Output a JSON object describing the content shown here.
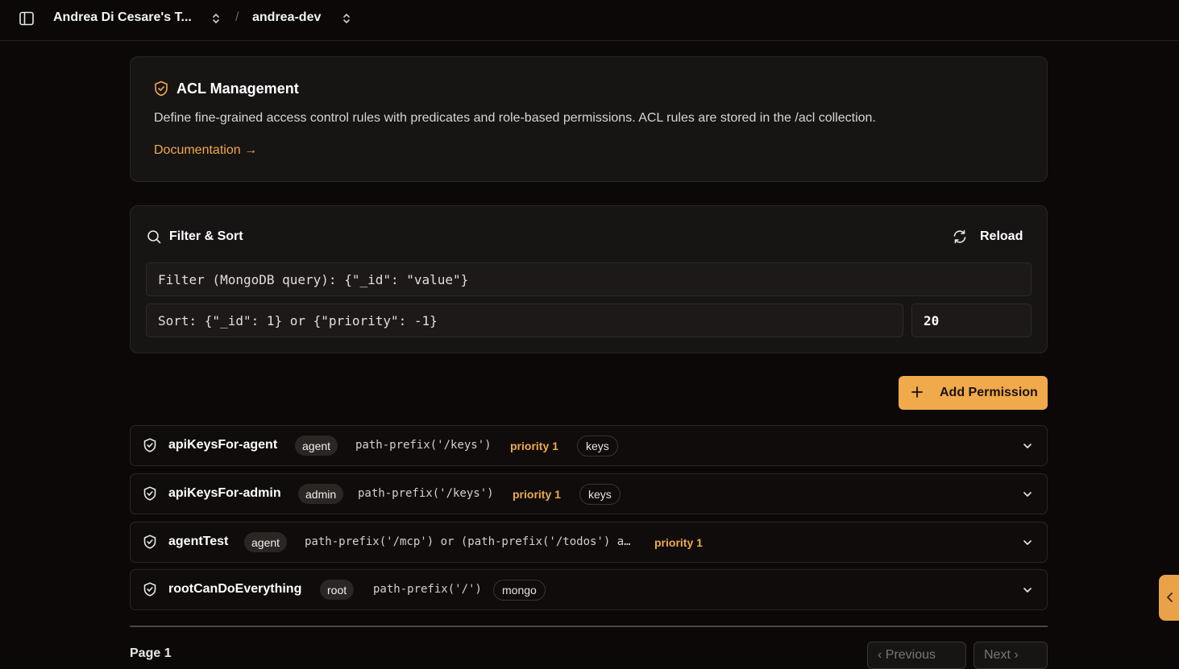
{
  "header": {
    "team_name": "Andrea Di Cesare's T...",
    "separator": "/",
    "project_name": "andrea-dev"
  },
  "acl": {
    "title": "ACL Management",
    "description": "Define fine-grained access control rules with predicates and role-based permissions. ACL rules are stored in the /acl collection.",
    "doc_link": "Documentation →"
  },
  "filter": {
    "title": "Filter & Sort",
    "reload_label": "Reload",
    "filter_placeholder": "Filter (MongoDB query): {\"_id\": \"value\"}",
    "sort_placeholder": "Sort: {\"_id\": 1} or {\"priority\": -1}",
    "limit_value": "20"
  },
  "actions": {
    "add_label": "Add Permission"
  },
  "rules": [
    {
      "name": "apiKeysFor-agent",
      "role": "agent",
      "predicate": "path-prefix('/keys')",
      "priority": "priority 1",
      "tag": "keys"
    },
    {
      "name": "apiKeysFor-admin",
      "role": "admin",
      "predicate": "path-prefix('/keys')",
      "priority": "priority 1",
      "tag": "keys"
    },
    {
      "name": "agentTest",
      "role": "agent",
      "predicate": "path-prefix('/mcp') or (path-prefix('/todos') a…",
      "priority": "priority 1",
      "tag": ""
    },
    {
      "name": "rootCanDoEverything",
      "role": "root",
      "predicate": "path-prefix('/')",
      "priority": "",
      "tag": "mongo"
    }
  ],
  "pagination": {
    "page_label": "Page 1",
    "prev_label": "‹ Previous",
    "next_label": "Next ›"
  },
  "colors": {
    "accent": "#f0a94b",
    "background": "#0b0807",
    "card": "#171414"
  }
}
